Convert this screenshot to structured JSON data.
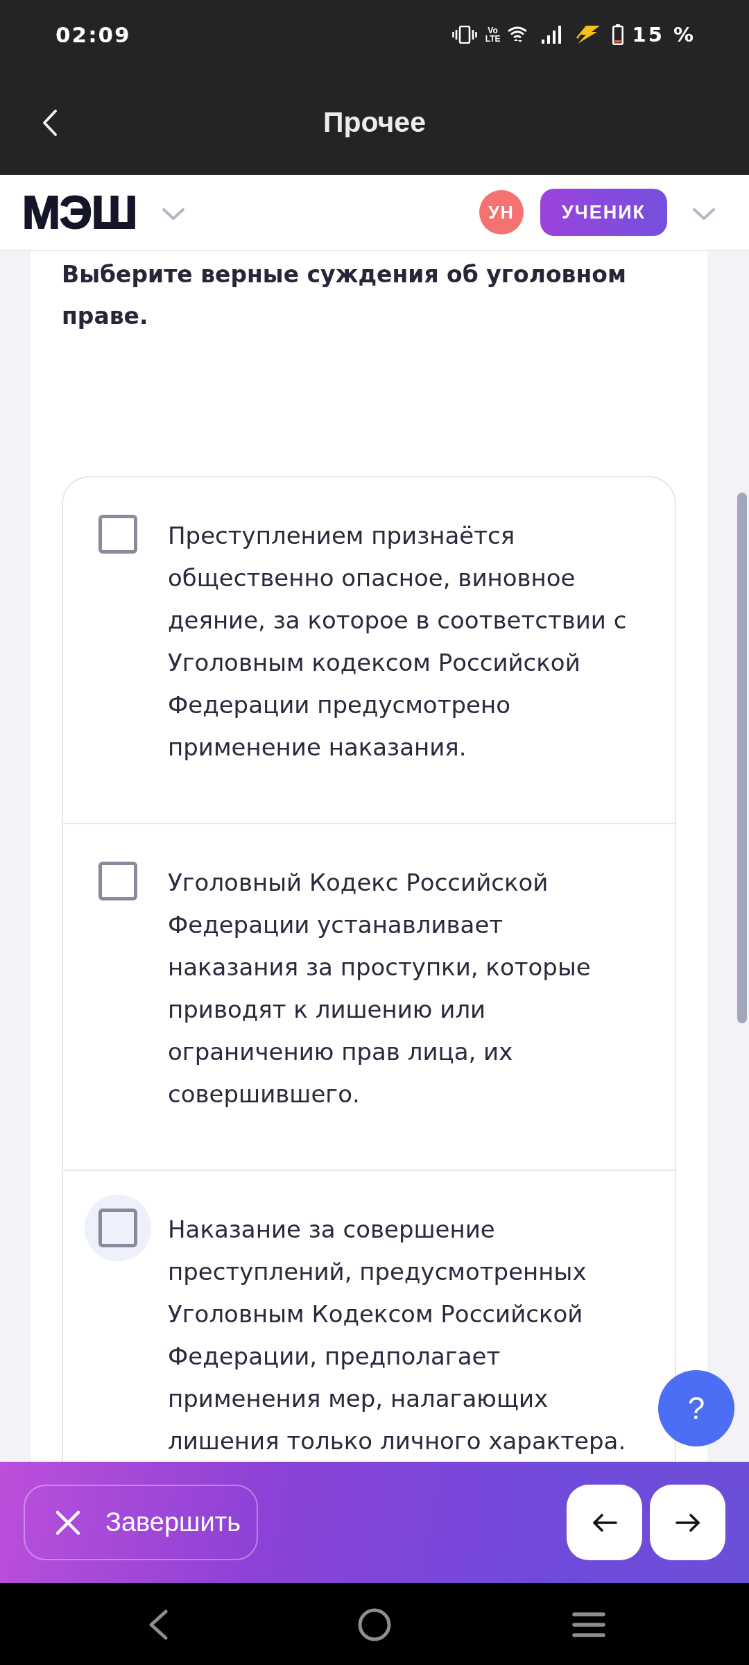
{
  "status_bar": {
    "time": "02:09",
    "volte_top": "Vo",
    "volte_bottom": "LTE",
    "battery_text": "15 %"
  },
  "app_bar": {
    "title": "Прочее"
  },
  "header": {
    "logo": "МЭШ",
    "avatar_initials": "УН",
    "role": "УЧЕНИК"
  },
  "question": {
    "prompt": "Выберите верные суждения об уголовном праве.",
    "options": [
      {
        "text": "Преступлением признаётся общественно опасное, виновное деяние, за которое в соответствии с Уголовным кодексом Российской Федерации предусмотрено применение наказания.",
        "checked": false,
        "focused": false
      },
      {
        "text": "Уголовный Кодекс Российской Федерации устанавливает наказания за проступки, которые приводят к лишению или ограничению прав лица, их совершившего.",
        "checked": false,
        "focused": false
      },
      {
        "text": "Наказание за совершение преступлений, предусмотренных Уголовным Кодексом Российской Федерации, предполагает применения мер, налагающих лишения только личного характера.",
        "checked": false,
        "focused": true
      }
    ]
  },
  "help_button": {
    "label": "?"
  },
  "footer": {
    "finish_label": "Завершить"
  }
}
